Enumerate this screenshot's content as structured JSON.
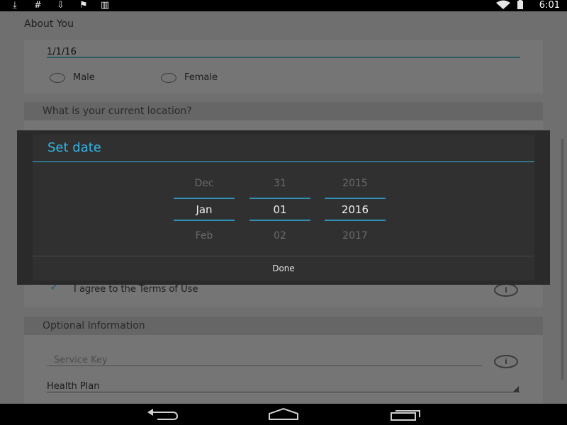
{
  "status_bar": {
    "time": "6:01",
    "left_icons": [
      "download-icon",
      "hash-icon",
      "download-box-icon",
      "flag-icon",
      "barcode-icon"
    ],
    "right_icons": [
      "wifi-icon",
      "battery-icon"
    ]
  },
  "form": {
    "about_you_title": "About You",
    "dob_value": "1/1/16",
    "gender_options": [
      "Male",
      "Female"
    ],
    "location_header": "What is your current location?",
    "terms_label": "I agree to the Terms of Use",
    "optional_header": "Optional Information",
    "service_key_placeholder": "Service Key",
    "health_plan_label": "Health Plan"
  },
  "dialog": {
    "title": "Set date",
    "month": {
      "prev": "Dec",
      "current": "Jan",
      "next": "Feb"
    },
    "day": {
      "prev": "31",
      "current": "01",
      "next": "02"
    },
    "year": {
      "prev": "2015",
      "current": "2016",
      "next": "2017"
    },
    "done_label": "Done"
  },
  "colors": {
    "accent": "#33b5e5",
    "dialog_bg": "#303030"
  }
}
